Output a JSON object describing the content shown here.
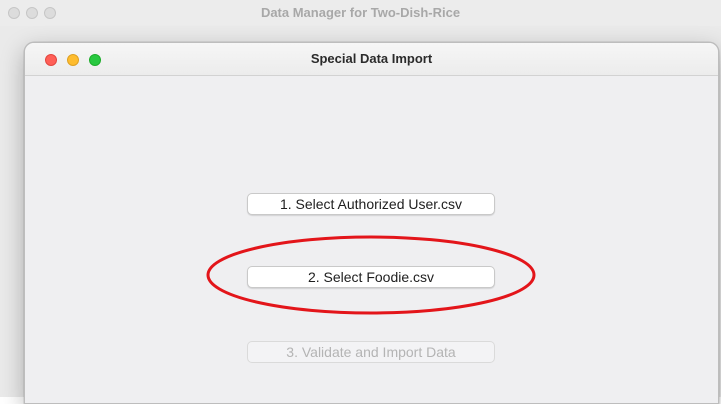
{
  "outer_window": {
    "title": "Data Manager for Two-Dish-Rice"
  },
  "dialog": {
    "title": "Special Data Import",
    "buttons": [
      {
        "label": "1. Select Authorized User.csv",
        "enabled": true
      },
      {
        "label": "2. Select Foodie.csv",
        "enabled": true,
        "highlighted": true
      },
      {
        "label": "3. Validate and Import Data",
        "enabled": false
      }
    ]
  },
  "colors": {
    "close": "#ff5f57",
    "minimize": "#febc2e",
    "zoom": "#28c840",
    "annotation": "#e3151a"
  }
}
